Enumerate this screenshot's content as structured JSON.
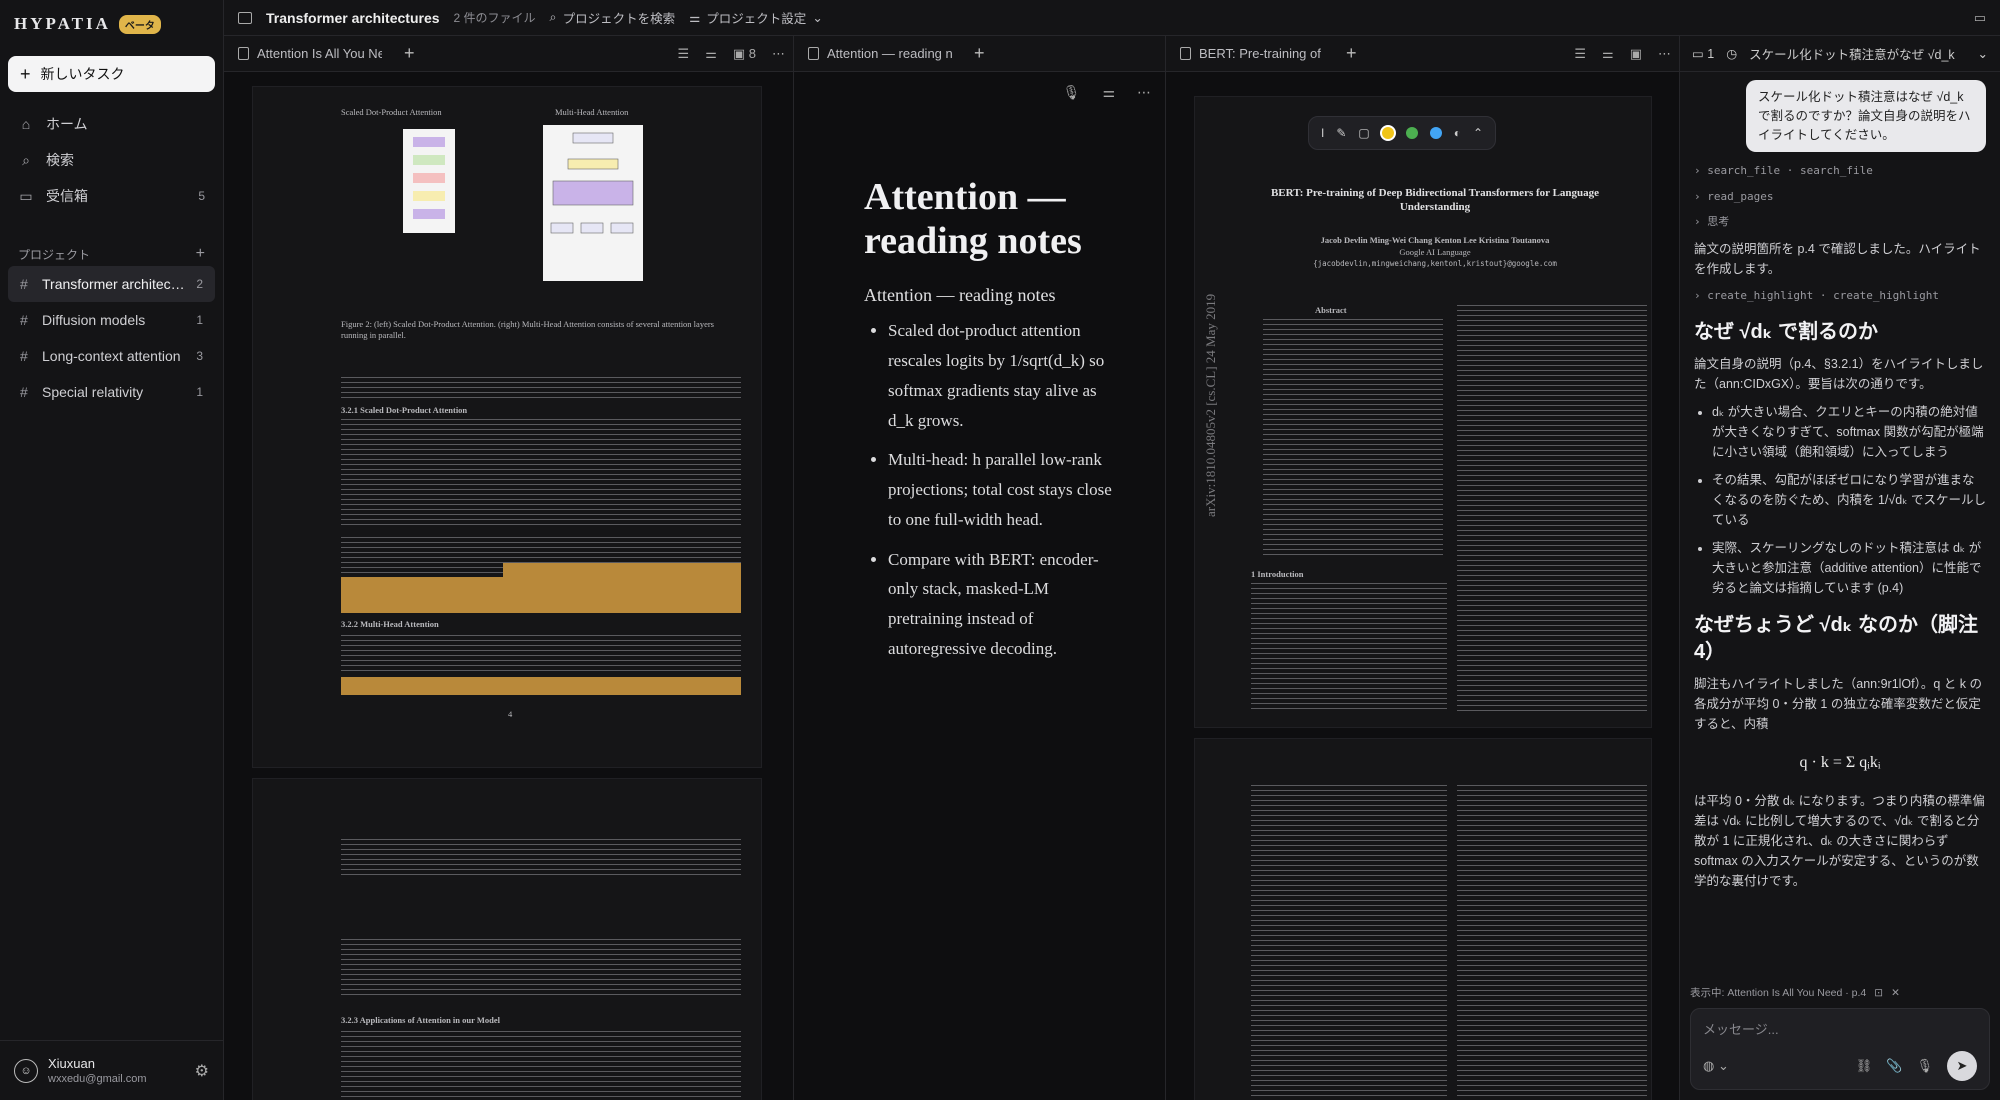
{
  "app": {
    "logo": "HYPATIA",
    "beta": "ベータ"
  },
  "sidebar": {
    "new_task": "新しいタスク",
    "nav": [
      {
        "label": "ホーム",
        "icon": "home-icon",
        "count": ""
      },
      {
        "label": "検索",
        "icon": "search-icon",
        "count": ""
      },
      {
        "label": "受信箱",
        "icon": "inbox-icon",
        "count": "5"
      }
    ],
    "projects_label": "プロジェクト",
    "projects": [
      {
        "name": "Transformer architectures",
        "count": "2",
        "active": true
      },
      {
        "name": "Diffusion models",
        "count": "1",
        "active": false
      },
      {
        "name": "Long-context attention",
        "count": "3",
        "active": false
      },
      {
        "name": "Special relativity",
        "count": "1",
        "active": false
      }
    ],
    "user": {
      "name": "Xiuxuan",
      "email": "wxxedu@gmail.com"
    }
  },
  "topbar": {
    "title": "Transformer architectures",
    "files": "2 件のファイル",
    "search": "プロジェクトを検索",
    "settings": "プロジェクト設定"
  },
  "panes": {
    "left": {
      "tab": "Attention Is All You Need",
      "page_count": "8"
    },
    "middle": {
      "tab": "Attention — reading notes",
      "title": "Attention — reading notes",
      "subtitle": "Attention — reading notes",
      "bullets": [
        "Scaled dot-product attention rescales logits by 1/sqrt(d_k) so softmax gradients stay alive as d_k grows.",
        "Multi-head: h parallel low-rank projections; total cost stays close to one full-width head.",
        "Compare with BERT: encoder-only stack, masked-LM pretraining instead of autoregressive decoding."
      ]
    },
    "right": {
      "tab": "BERT: Pre-training of Deep Bidirectional Transformers"
    }
  },
  "paper_attention": {
    "fig_left": "Scaled Dot-Product Attention",
    "fig_right": "Multi-Head Attention",
    "caption": "Figure 2: (left) Scaled Dot-Product Attention. (right) Multi-Head Attention consists of several attention layers running in parallel.",
    "s321": "3.2.1 Scaled Dot-Product Attention",
    "s322": "3.2.2 Multi-Head Attention",
    "s323": "3.2.3 Applications of Attention in our Model",
    "page": "4"
  },
  "paper_bert": {
    "title": "BERT: Pre-training of Deep Bidirectional Transformers for Language Understanding",
    "authors": "Jacob Devlin   Ming-Wei Chang   Kenton Lee   Kristina Toutanova",
    "affil": "Google AI Language",
    "emails": "{jacobdevlin,mingweichang,kentonl,kristout}@google.com",
    "abstract": "Abstract",
    "intro": "1 Introduction",
    "arxiv": "arXiv:1810.04805v2 [cs.CL] 24 May 2019"
  },
  "chat": {
    "tab_count": "1",
    "thread_title": "スケール化ドット積注意がなぜ √d_k",
    "question": "スケール化ドット積注意はなぜ √d_k で割るのですか？論文自身の説明をハイライトしてください。",
    "tools": [
      "search_file · search_file",
      "read_pages",
      "思考"
    ],
    "found": "論文の説明箇所を p.4 で確認しました。ハイライトを作成します。",
    "tool_hl": "create_highlight · create_highlight",
    "h1": "なぜ √dₖ で割るのか",
    "p1": "論文自身の説明（p.4、§3.2.1）をハイライトしました（ann:CIDxGX）。要旨は次の通りです。",
    "b1": "dₖ が大きい場合、クエリとキーの内積の絶対値が大きくなりすぎて、softmax 関数が勾配が極端に小さい領域（飽和領域）に入ってしまう",
    "b2": "その結果、勾配がほぼゼロになり学習が進まなくなるのを防ぐため、内積を 1/√dₖ でスケールしている",
    "b3": "実際、スケーリングなしのドット積注意は dₖ が大きいと参加注意（additive attention）に性能で劣ると論文は指摘しています (p.4)",
    "h2": "なぜちょうど √dₖ なのか（脚注4）",
    "p2": "脚注もハイライトしました（ann:9r1lOf）。q と k の各成分が平均 0・分散 1 の独立な確率変数だと仮定すると、内積",
    "eq": "q · k = Σ qᵢkᵢ",
    "p3": "は平均 0・分散 dₖ になります。つまり内積の標準偏差は √dₖ に比例して増大するので、√dₖ で割ると分散が 1 に正規化され、dₖ の大きさに関わらず softmax の入力スケールが安定する、というのが数学的な裏付けです。",
    "context": "表示中: Attention Is All You Need · p.4",
    "placeholder": "メッセージ..."
  }
}
